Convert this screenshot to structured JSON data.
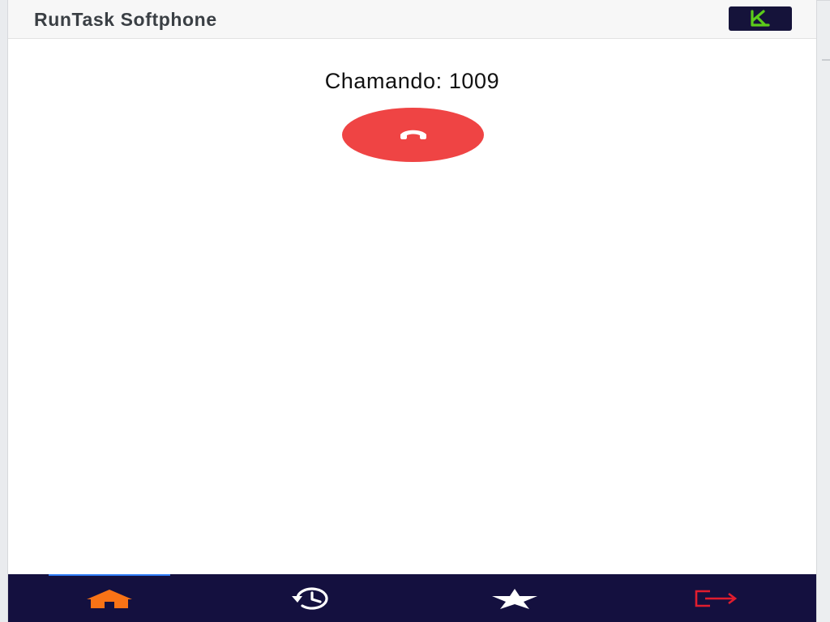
{
  "header": {
    "title": "RunTask Softphone",
    "logo_icon": "runtask-k-logo"
  },
  "call": {
    "status_label": "Chamando:",
    "number": "1009",
    "hangup_icon": "phone-hangup-icon"
  },
  "tabbar": {
    "active_tab": "home",
    "tabs": [
      {
        "id": "home",
        "icon": "home-icon",
        "color": "#f97316"
      },
      {
        "id": "history",
        "icon": "history-icon",
        "color": "#ffffff"
      },
      {
        "id": "favorites",
        "icon": "star-icon",
        "color": "#ffffff"
      },
      {
        "id": "logout",
        "icon": "logout-icon",
        "color": "#e11d2e"
      }
    ]
  },
  "colors": {
    "tabbar_bg": "#14103f",
    "hangup_red": "#ef4444",
    "active_indicator": "#2f7cf6",
    "logo_green": "#5ccc1a"
  }
}
